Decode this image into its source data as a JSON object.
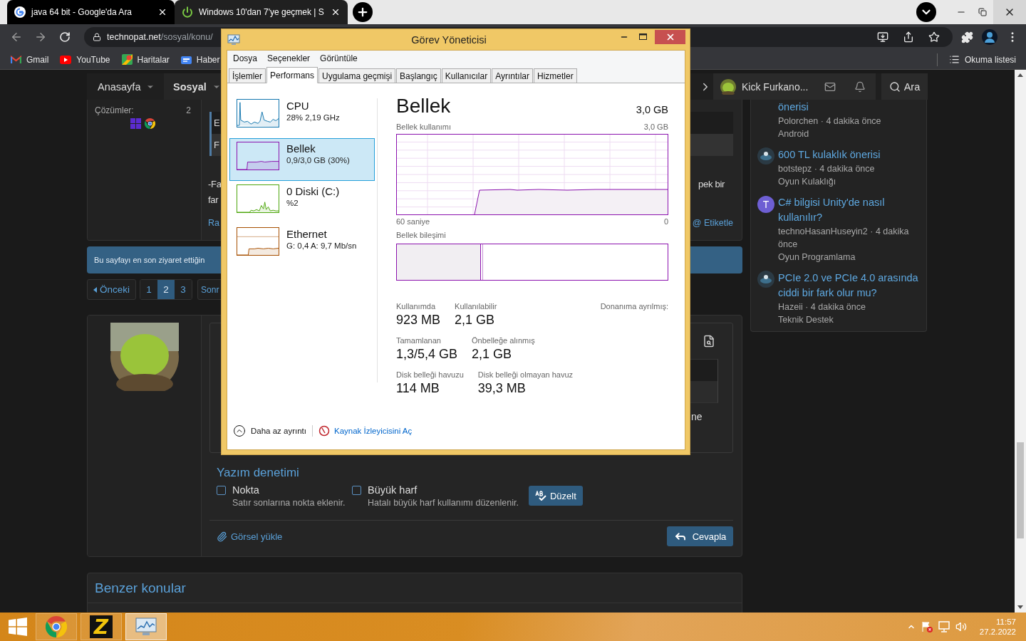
{
  "browser": {
    "tabs": [
      {
        "title": "java 64 bit - Google'da Ara",
        "kind": "google",
        "selected": false
      },
      {
        "title": "Windows 10'dan 7'ye geçmek | S",
        "kind": "power",
        "selected": true
      }
    ],
    "address": {
      "domain": "technopat.net",
      "path": "/sosyal/konu/"
    },
    "bookmarks": [
      {
        "label": "Gmail",
        "kind": "gmail"
      },
      {
        "label": "YouTube",
        "kind": "youtube"
      },
      {
        "label": "Haritalar",
        "kind": "maps"
      },
      {
        "label": "Haber",
        "kind": "news"
      }
    ],
    "reading_list": "Okuma listesi"
  },
  "forum_nav": {
    "items": [
      {
        "label": "Anasayfa",
        "selected": false
      },
      {
        "label": "Sosyal",
        "selected": true
      }
    ],
    "user": "Kick Furkano...",
    "search": "Ara"
  },
  "post": {
    "stat_label": "Çözümler:",
    "stat_value": "2",
    "quote_rows": [
      "E",
      "F"
    ],
    "lines": [
      {
        "left": "-Fa",
        "right": "pek bir"
      },
      {
        "left": "far"
      }
    ],
    "report_link": "Ra",
    "tag_link": "@ Etiketle"
  },
  "banner": "Bu sayfayı en son ziyaret ettiğin",
  "pagination": {
    "prev": "Önceki",
    "pages": [
      {
        "label": "1",
        "selected": false
      },
      {
        "label": "2",
        "selected": true
      },
      {
        "label": "3",
        "selected": false
      }
    ],
    "next": "Sonr"
  },
  "reply": {
    "editor_text": "ne",
    "spellcheck": {
      "title": "Yazım denetimi",
      "options": [
        {
          "label": "Nokta",
          "hint": "Satır sonlarına nokta eklenir.",
          "checked": false
        },
        {
          "label": "Büyük harf",
          "hint": "Hatalı büyük harf kullanımı düzenlenir.",
          "checked": false
        }
      ],
      "fix_button": "Düzelt"
    },
    "upload": "Görsel yükle",
    "submit": "Cevapla"
  },
  "similar": {
    "title": "Benzer konular"
  },
  "sidebar": {
    "threads": [
      {
        "title": "önerisi",
        "meta": "Polorchen · 4 dakika önce",
        "forum": "Android"
      },
      {
        "title": "600 TL kulaklık önerisi",
        "meta": "botstepz · 4 dakika önce",
        "forum": "Oyun Kulaklığı"
      },
      {
        "title": "C# bilgisi Unity'de nasıl kullanılır?",
        "meta": "technoHasanHuseyin2 · 4 dakika önce",
        "forum": "Oyun Programlama",
        "avatar": {
          "kind": "letter",
          "letter": "T",
          "color": "#6e5fd3"
        }
      },
      {
        "title": "PCIe 2.0 ve PCIe 4.0 arasında ciddi bir fark olur mu?",
        "meta": "Hazeii · 4 dakika önce",
        "forum": "Teknik Destek"
      }
    ]
  },
  "task_manager": {
    "title": "Görev Yöneticisi",
    "menu": [
      "Dosya",
      "Seçenekler",
      "Görüntüle"
    ],
    "tabs": [
      {
        "label": "İşlemler",
        "selected": false
      },
      {
        "label": "Performans",
        "selected": true
      },
      {
        "label": "Uygulama geçmişi",
        "selected": false
      },
      {
        "label": "Başlangıç",
        "selected": false
      },
      {
        "label": "Kullanıcılar",
        "selected": false
      },
      {
        "label": "Ayrıntılar",
        "selected": false
      },
      {
        "label": "Hizmetler",
        "selected": false
      }
    ],
    "resources": [
      {
        "kind": "cpu",
        "title": "CPU",
        "detail": "28%  2,19 GHz",
        "color": "#1175ae",
        "selected": false
      },
      {
        "kind": "memory",
        "title": "Bellek",
        "detail": "0,9/3,0 GB (30%)",
        "color": "#8b12ae",
        "selected": true
      },
      {
        "kind": "disk",
        "title": "0 Diski (C:)",
        "detail": "%2",
        "color": "#4da60c",
        "selected": false
      },
      {
        "kind": "network",
        "title": "Ethernet",
        "detail": "G: 0,4 A: 9,7 Mb/sn",
        "color": "#a74f01",
        "selected": false
      }
    ],
    "detail": {
      "title": "Bellek",
      "total": "3,0 GB",
      "usage_label": "Bellek kullanımı",
      "usage_max": "3,0 GB",
      "time_label": "60 saniye",
      "time_end": "0",
      "composition_label": "Bellek bileşimi",
      "composition": {
        "level": 0.31
      },
      "stats": [
        {
          "items": [
            {
              "label": "Kullanımda",
              "value": "923 MB"
            },
            {
              "label": "Kullanılabilir",
              "value": "2,1 GB"
            },
            {
              "label": "Donanıma ayrılmış:"
            }
          ]
        },
        {
          "items": [
            {
              "label": "Tamamlanan",
              "value": "1,3/5,4 GB"
            },
            {
              "label": "Önbelleğe alınmış",
              "value": "2,1 GB"
            }
          ]
        },
        {
          "items": [
            {
              "label": "Disk belleği havuzu",
              "value": "114 MB"
            },
            {
              "label": "Disk belleği olmayan havuz",
              "value": "39,3 MB"
            }
          ]
        }
      ]
    },
    "footer": {
      "less_details": "Daha az ayrıntı",
      "monitor_link": "Kaynak İzleyicisini Aç"
    }
  },
  "taskbar": {
    "apps": [
      {
        "kind": "chrome",
        "selected": false
      },
      {
        "kind": "app",
        "label": "Z",
        "selected": false
      },
      {
        "kind": "taskmgr",
        "selected": true
      }
    ],
    "time": "11:57",
    "date": "27.2.2022"
  }
}
